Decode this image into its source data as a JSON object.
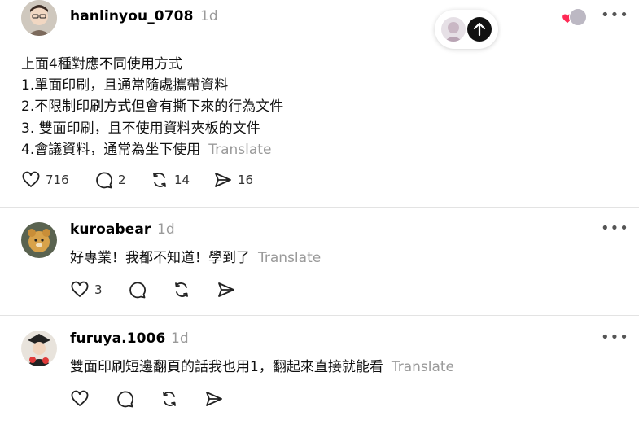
{
  "posts": [
    {
      "username": "hanlinyou_0708",
      "time": "1d",
      "lines": [
        "上面4種對應不同使用方式",
        "1.單面印刷，且通常隨處攜帶資料",
        "2.不限制印刷方式但會有撕下來的行為文件",
        "3. 雙面印刷，且不使用資料夾板的文件",
        "4.會議資料，通常為坐下使用"
      ],
      "translate": "Translate",
      "likes": "716",
      "replies": "2",
      "reposts": "14",
      "shares": "16"
    },
    {
      "username": "kuroabear",
      "time": "1d",
      "text": "好專業！我都不知道！學到了",
      "translate": "Translate",
      "likes": "3"
    },
    {
      "username": "furuya.1006",
      "time": "1d",
      "text": "雙面印刷短邊翻頁的話我也用1，翻起來直接就能看",
      "translate": "Translate"
    }
  ],
  "more_label": "•••",
  "icons": [
    "heart-icon",
    "comment-icon",
    "repost-icon",
    "share-icon",
    "arrow-up-icon"
  ],
  "colors": {
    "like_heart": "#ff2a55",
    "muted": "#9a9a9a",
    "divider": "#e3e3e3"
  }
}
